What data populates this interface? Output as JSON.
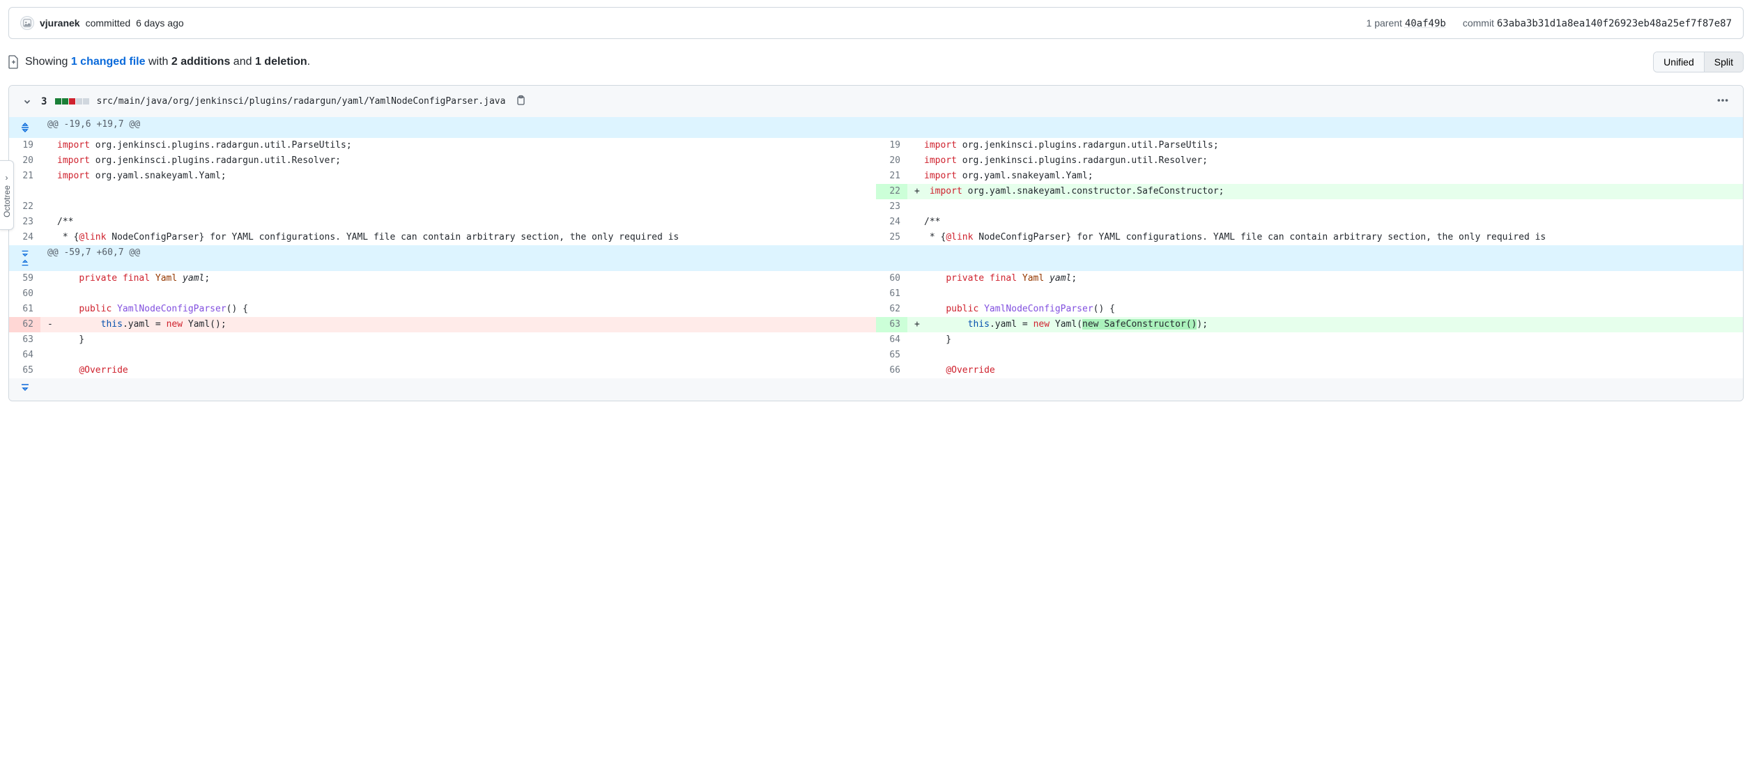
{
  "commit": {
    "author": "vjuranek",
    "time": "6 days ago",
    "verb": "committed",
    "parent_label": "1 parent",
    "parent_sha_short": "40af49b",
    "commit_label": "commit",
    "sha_long": "63aba3b31d1a8ea140f26923eb48a25ef7f87e87"
  },
  "summary": {
    "showing": "Showing",
    "changed_files": "1 changed file",
    "with": "with",
    "additions": "2 additions",
    "and": "and",
    "deletions": "1 deletion",
    "period": "."
  },
  "view_toggle": {
    "unified": "Unified",
    "split": "Split",
    "selected": "split"
  },
  "file": {
    "count": "3",
    "path": "src/main/java/org/jenkinsci/plugins/radargun/yaml/YamlNodeConfigParser.java",
    "hunk1": "@@ -19,6 +19,7 @@",
    "hunk2": "@@ -59,7 +60,7 @@"
  },
  "lines": {
    "l19": {
      "ln": "19",
      "kw": "import",
      "rest": " org.jenkinsci.plugins.radargun.util.ParseUtils;"
    },
    "r19": {
      "ln": "19"
    },
    "l20": {
      "ln": "20",
      "kw": "import",
      "rest": " org.jenkinsci.plugins.radargun.util.Resolver;"
    },
    "r20": {
      "ln": "20"
    },
    "l21": {
      "ln": "21",
      "kw": "import",
      "rest": " org.yaml.snakeyaml.Yaml;"
    },
    "r21": {
      "ln": "21"
    },
    "r22": {
      "ln": "22",
      "marker": "+",
      "kw": "import",
      "rest": " org.yaml.snakeyaml.constructor.SafeConstructor;"
    },
    "l22e": {
      "ln": "22"
    },
    "r23": {
      "ln": "23"
    },
    "l23": {
      "ln": "23",
      "txt": "/**"
    },
    "r24": {
      "ln": "24"
    },
    "l24": {
      "ln": "24",
      "pre": " * {",
      "ann": "@link",
      "mid": " NodeConfigParser} for YAML configurations. YAML file can contain arbitrary section, the only required is"
    },
    "r25": {
      "ln": "25"
    },
    "l59": {
      "ln": "59",
      "pre": "    ",
      "kw1": "private",
      "kw2": "final",
      "type": "Yaml",
      "name": "yaml",
      "tail": ";"
    },
    "r60": {
      "ln": "60"
    },
    "l60": {
      "ln": "60"
    },
    "r61": {
      "ln": "61"
    },
    "l61": {
      "ln": "61",
      "kw": "public",
      "fn": "YamlNodeConfigParser",
      "rest": "() {"
    },
    "r62": {
      "ln": "62"
    },
    "l62": {
      "ln": "62",
      "marker": "-",
      "pre": "        ",
      "thiskw": "this",
      "mid": ".yaml = ",
      "newkw": "new",
      "call": " Yaml();"
    },
    "r63": {
      "ln": "63",
      "marker": "+",
      "pre": "        ",
      "thiskw": "this",
      "mid": ".yaml = ",
      "newkw": "new",
      "call_a": " Yaml(",
      "hl": "new SafeConstructor()",
      "call_b": ");"
    },
    "l63": {
      "ln": "63",
      "txt": "    }"
    },
    "r64": {
      "ln": "64"
    },
    "l64": {
      "ln": "64"
    },
    "r65": {
      "ln": "65"
    },
    "l65": {
      "ln": "65",
      "pre": "    ",
      "ann": "@Override"
    },
    "r66": {
      "ln": "66"
    }
  },
  "octotree": "Octotree"
}
